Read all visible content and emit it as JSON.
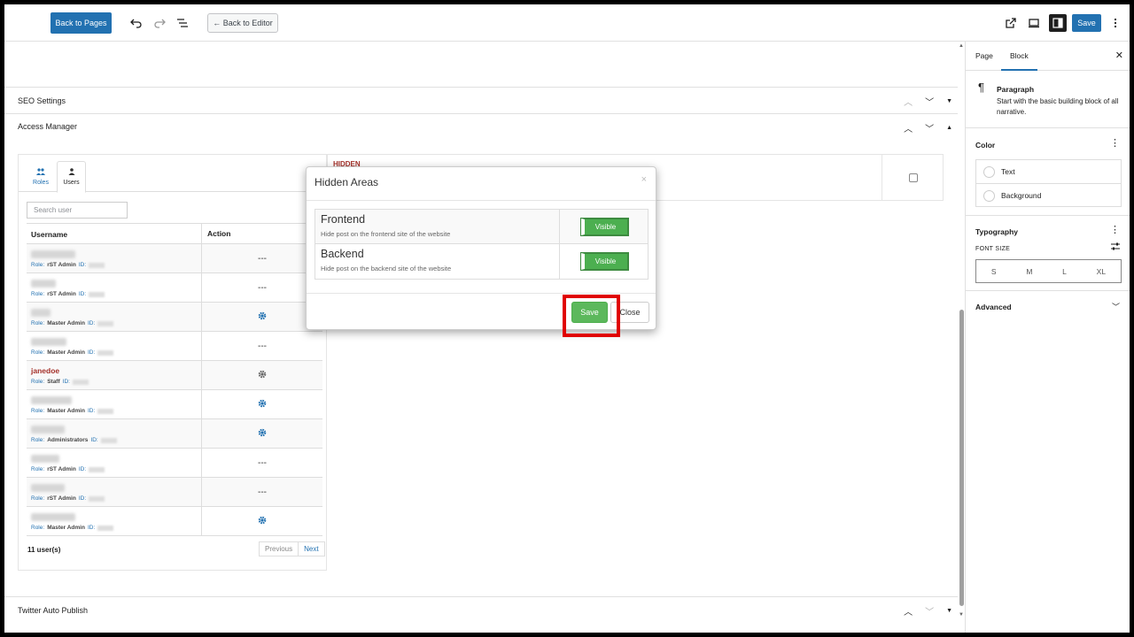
{
  "topbar": {
    "back_to_pages": "Back to Pages",
    "back_to_editor": "← Back to Editor",
    "save": "Save",
    "icons": [
      "undo-icon",
      "redo-icon",
      "list-view-icon",
      "external-link-icon",
      "desktop-preview-icon",
      "sidebar-toggle-icon",
      "more-options-icon"
    ]
  },
  "metaboxes": {
    "seo": "SEO Settings",
    "access_manager": "Access Manager",
    "twitter": "Twitter Auto Publish"
  },
  "access_manager": {
    "tabs": [
      {
        "label": "Roles",
        "icon": "users-icon"
      },
      {
        "label": "Users",
        "icon": "user-icon"
      }
    ],
    "search_placeholder": "Search user",
    "columns": [
      "Username",
      "Action"
    ],
    "role_label": "Role:",
    "id_label": "ID:",
    "users": [
      {
        "name": "",
        "role": "rST Admin",
        "action": "---"
      },
      {
        "name": "",
        "role": "rST Admin",
        "action": "---"
      },
      {
        "name": "",
        "role": "Master Admin",
        "action": "gear"
      },
      {
        "name": "",
        "role": "Master Admin",
        "action": "---"
      },
      {
        "name": "janedoe",
        "role": "Staff",
        "action": "gear"
      },
      {
        "name": "",
        "role": "Master Admin",
        "action": "gear"
      },
      {
        "name": "",
        "role": "Administrators",
        "action": "gear"
      },
      {
        "name": "",
        "role": "rST Admin",
        "action": "---"
      },
      {
        "name": "",
        "role": "rST Admin",
        "action": "---"
      },
      {
        "name": "",
        "role": "Master Admin",
        "action": "gear"
      }
    ],
    "user_count": "11 user(s)",
    "previous": "Previous",
    "next": "Next",
    "hidden_label": "HIDDEN"
  },
  "modal": {
    "title": "Hidden Areas",
    "close_x": "×",
    "areas": [
      {
        "name": "Frontend",
        "desc": "Hide post on the frontend site of the website",
        "state": "Visible"
      },
      {
        "name": "Backend",
        "desc": "Hide post on the backend site of the website",
        "state": "Visible"
      }
    ],
    "save": "Save",
    "close": "Close"
  },
  "sidebar": {
    "tabs": [
      "Page",
      "Block"
    ],
    "active_tab": "Block",
    "block_icon": "¶",
    "block_title": "Paragraph",
    "block_desc": "Start with the basic building block of all narrative.",
    "color_title": "Color",
    "colors": [
      "Text",
      "Background"
    ],
    "typography_title": "Typography",
    "font_size_label": "FONT SIZE",
    "font_sizes": [
      "S",
      "M",
      "L",
      "XL"
    ],
    "advanced_title": "Advanced"
  },
  "colors": {
    "primary": "#2271b1",
    "success": "#5cb85c",
    "highlight": "#e00000",
    "username_red": "#a5312a"
  }
}
